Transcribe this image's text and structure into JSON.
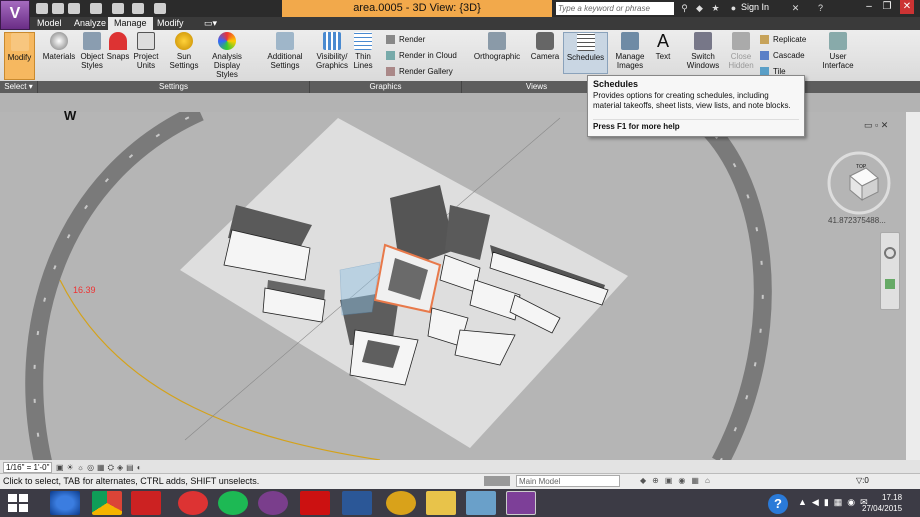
{
  "app": {
    "title": "area.0005 - 3D View: {3D}",
    "app_letter": "V"
  },
  "search": {
    "placeholder": "Type a keyword or phrase"
  },
  "header": {
    "sign_in": "Sign In"
  },
  "tabs": [
    {
      "label": "Model"
    },
    {
      "label": "Analyze"
    },
    {
      "label": "Manage",
      "active": true
    },
    {
      "label": "Modify"
    }
  ],
  "ribbon": {
    "buttons": [
      "Modify",
      "Materials",
      "Object Styles",
      "Snaps",
      "Project Units",
      "Sun Settings",
      "Analysis Display Styles",
      "Additional Settings",
      "Visibility/ Graphics",
      "Thin Lines",
      "Orthographic",
      "Camera",
      "Schedules",
      "Manage Images",
      "Text",
      "Switch Windows",
      "Close Hidden",
      "User Interface"
    ],
    "render_items": [
      "Render",
      "Render  in Cloud",
      "Render  Gallery"
    ],
    "window_items": [
      "Replicate",
      "Cascade",
      "Tile"
    ],
    "panels": [
      "Select",
      "Settings",
      "Graphics",
      "Views"
    ]
  },
  "tooltip": {
    "title": "Schedules",
    "description": "Provides options for creating schedules, including material takeoffs, sheet lists, view lists, and note blocks.",
    "help": "Press F1 for more help"
  },
  "viewport": {
    "compass_w": "W",
    "angle_label": "16.39",
    "coord_readout": "41.872375488...",
    "cube_label": "TOP"
  },
  "statusbar": {
    "scale": "1/16\" = 1'-0\"",
    "message": "Click to select, TAB for alternates, CTRL adds, SHIFT unselects.",
    "model_selector": "Main Model",
    "filter_count": ":0"
  },
  "taskbar": {
    "time": "17.18",
    "date": "27/04/2015"
  },
  "colors": {
    "accent": "#f6b860",
    "doc_tab": "#f2a94b",
    "highlight": "#e8794a",
    "glass": "#8fc3e6"
  }
}
